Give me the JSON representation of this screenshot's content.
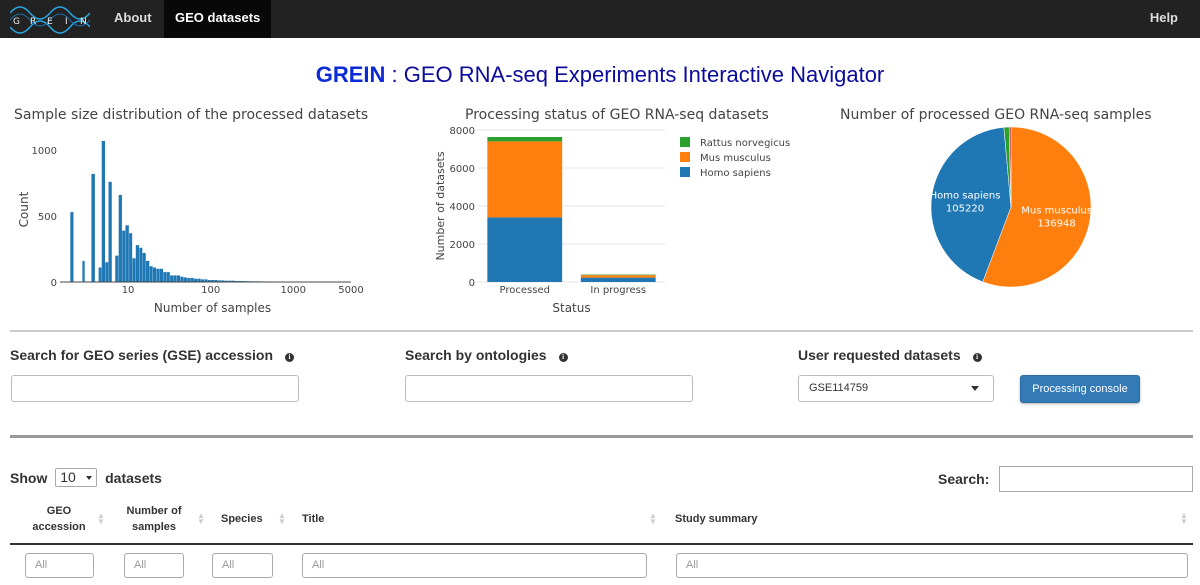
{
  "nav": {
    "logo_letters": [
      "G",
      "R",
      "E",
      "I",
      "N"
    ],
    "about": "About",
    "geo_datasets": "GEO datasets",
    "help": "Help"
  },
  "header": {
    "brand": "GREIN",
    "separator": " : ",
    "subtitle": "GEO RNA-seq Experiments Interactive Navigator"
  },
  "colors": {
    "navbar": "#222222",
    "title": "#0b0b9c",
    "histogram_bar": "#1f77b4",
    "homo_sapiens": "#1f77b4",
    "mus_musculus": "#ff7f0e",
    "rattus_norvegicus": "#2ca02c",
    "button": "#337ab7"
  },
  "chart_data": [
    {
      "type": "bar",
      "title": "Sample size distribution of the processed datasets",
      "xlabel": "Number of samples",
      "ylabel": "Count",
      "x_scale": "log",
      "xlim": [
        1.5,
        5000
      ],
      "ylim": [
        0,
        1100
      ],
      "x_ticks": [
        10,
        100,
        1000,
        5000
      ],
      "x_tick_labels": [
        "10",
        "100",
        "1000",
        "5000"
      ],
      "y_ticks": [
        0,
        500,
        1000
      ],
      "y_tick_labels": [
        "0",
        "500",
        "1000"
      ],
      "x": [
        2,
        2.2,
        2.4,
        2.6,
        2.8,
        3,
        3.3,
        3.6,
        4,
        4.4,
        4.8,
        5.3,
        5.8,
        6.4,
        7,
        7.7,
        8.5,
        9.3,
        10.3,
        11.3,
        12.4,
        13.7,
        15,
        16.5,
        18.2,
        20,
        22,
        24.2,
        26.7,
        29.3,
        32.3,
        35.5,
        39,
        43,
        47,
        52,
        57,
        63,
        69,
        76,
        84,
        92,
        101,
        111,
        122,
        134,
        148,
        163,
        179,
        197,
        217,
        239,
        263,
        289,
        318,
        350,
        385,
        424,
        466,
        513,
        564,
        621,
        683,
        751,
        826,
        909,
        1000,
        1100,
        1210,
        1331,
        1464,
        1611,
        1772,
        1949,
        2144,
        2358,
        2594,
        2853,
        3138,
        3452,
        3797,
        4177
      ],
      "values": [
        530,
        0,
        0,
        0,
        160,
        0,
        0,
        820,
        0,
        110,
        1070,
        150,
        760,
        0,
        200,
        660,
        390,
        430,
        370,
        180,
        280,
        260,
        220,
        160,
        120,
        110,
        100,
        100,
        75,
        75,
        50,
        50,
        50,
        40,
        35,
        30,
        30,
        25,
        25,
        20,
        20,
        15,
        15,
        15,
        12,
        12,
        10,
        10,
        10,
        8,
        8,
        7,
        6,
        6,
        5,
        5,
        5,
        4,
        4,
        4,
        3,
        3,
        3,
        3,
        2,
        2,
        2,
        2,
        2,
        2,
        1,
        1,
        1,
        1,
        1,
        1,
        1,
        1,
        1,
        1,
        1
      ]
    },
    {
      "type": "bar",
      "stacked": true,
      "title": "Processing status of GEO RNA-seq datasets",
      "xlabel": "Status",
      "ylabel": "Number of datasets",
      "ylim": [
        0,
        8000
      ],
      "y_ticks": [
        0,
        2000,
        4000,
        6000,
        8000
      ],
      "y_tick_labels": [
        "0",
        "2000",
        "4000",
        "6000",
        "8000"
      ],
      "categories": [
        "Processed",
        "In progress"
      ],
      "legend_position": "right",
      "series": [
        {
          "name": "Homo sapiens",
          "values": [
            3400,
            230
          ]
        },
        {
          "name": "Mus musculus",
          "values": [
            4000,
            130
          ]
        },
        {
          "name": "Rattus norvegicus",
          "values": [
            230,
            30
          ]
        }
      ]
    },
    {
      "type": "pie",
      "title": "Number of processed GEO RNA-seq samples",
      "slices": [
        {
          "label": "Mus musculus",
          "value": 136948
        },
        {
          "label": "Homo sapiens",
          "value": 105220
        },
        {
          "label": "Rattus norvegicus",
          "value": 2600
        },
        {
          "label": "",
          "value": 900
        }
      ]
    }
  ],
  "search": {
    "gse_label": "Search for GEO series (GSE) accession",
    "ontology_label": "Search by ontologies",
    "user_requested_label": "User requested datasets",
    "user_requested_value": "GSE114759",
    "processing_button": "Processing console",
    "info_glyph": "i"
  },
  "table": {
    "show_label": "Show",
    "page_length": "10",
    "datasets_label": "datasets",
    "search_label": "Search:",
    "sort_glyph_up": "▲",
    "sort_glyph_down": "▼",
    "headers": {
      "accession_l1": "GEO",
      "accession_l2": "accession",
      "samples_l1": "Number of",
      "samples_l2": "samples",
      "species": "Species",
      "title": "Title",
      "summary": "Study summary"
    },
    "filter_placeholder": "All"
  }
}
